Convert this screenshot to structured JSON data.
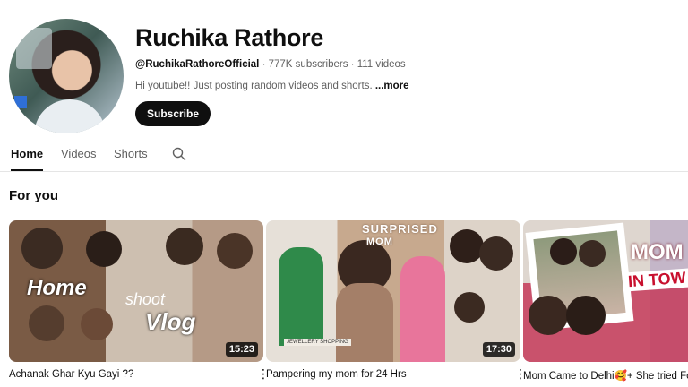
{
  "channel": {
    "name": "Ruchika Rathore",
    "handle": "@RuchikaRathoreOfficial",
    "subscribers": "777K subscribers",
    "videos": "111 videos",
    "separator": " · ",
    "description": "Hi youtube!! Just posting random videos and shorts. ",
    "more": "...more",
    "subscribe_label": "Subscribe"
  },
  "tabs": [
    {
      "label": "Home",
      "active": true
    },
    {
      "label": "Videos",
      "active": false
    },
    {
      "label": "Shorts",
      "active": false
    }
  ],
  "section": {
    "title": "For you"
  },
  "videos": [
    {
      "title": "Achanak Ghar Kyu Gayi ??",
      "duration": "15:23",
      "overlay": [
        "Home",
        "Vlog",
        "shoot"
      ]
    },
    {
      "title": "Pampering my mom for 24 Hrs",
      "duration": "17:30",
      "overlay": [
        "SURPRISED",
        "MOM",
        "JEWELLERY SHOPPING"
      ]
    },
    {
      "title": "Mom Came to Delhi🥰+ She tried Fo",
      "duration": "",
      "overlay": [
        "MOM",
        "IN TOW"
      ]
    }
  ],
  "colors": {
    "text_primary": "#0f0f0f",
    "text_secondary": "#606060",
    "subscribe_bg": "#0f0f0f",
    "divider": "#e5e5e5"
  },
  "icons": {
    "search_tab": "search-icon",
    "menu": "more-vert-icon"
  }
}
